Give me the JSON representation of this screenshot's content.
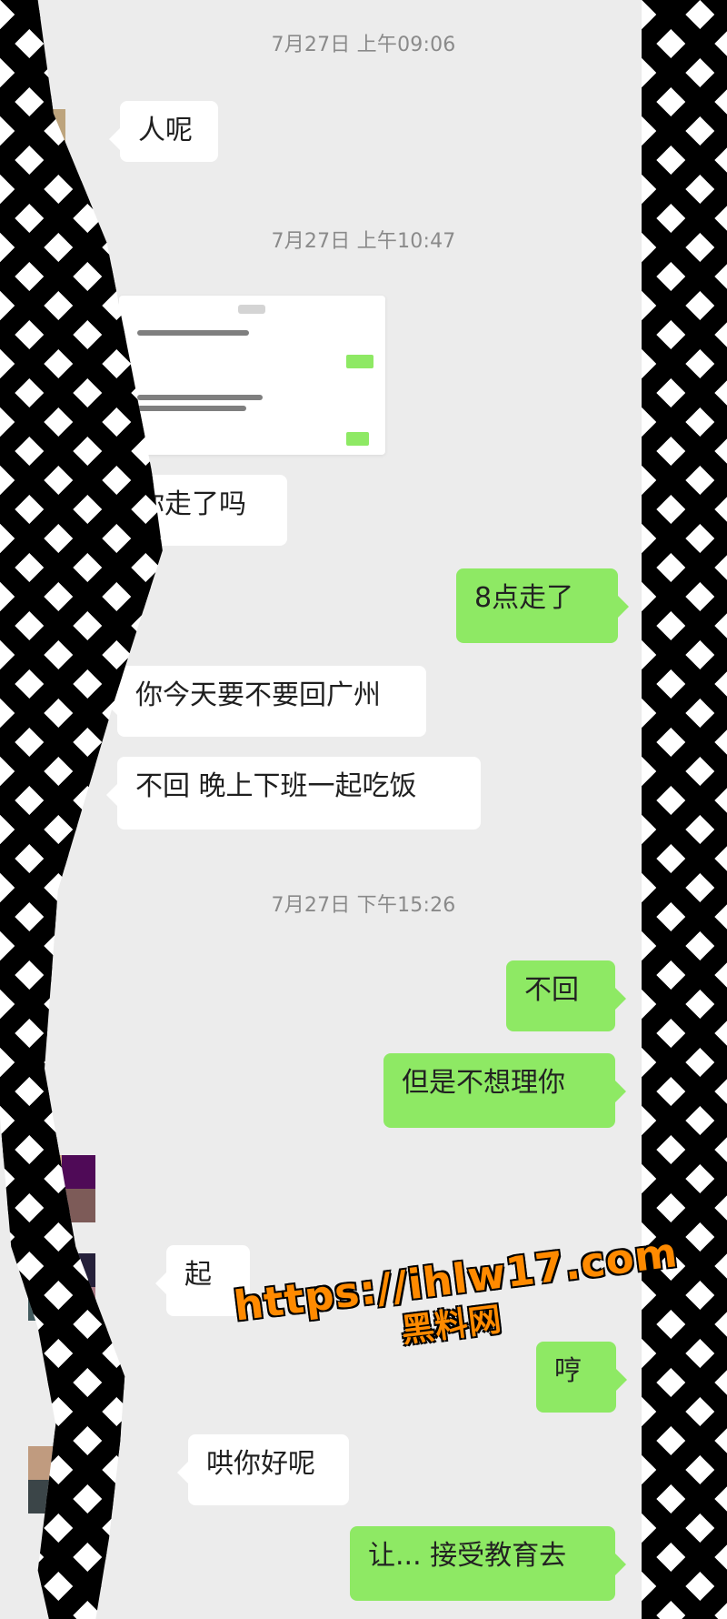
{
  "timestamps": {
    "first": "7月27日 上午09:06",
    "second": "7月27日 上午10:47",
    "third": "7月27日 下午15:26"
  },
  "messages": [
    {
      "side": "left",
      "text": "人呢"
    },
    {
      "side": "left",
      "text": "你走了吗"
    },
    {
      "side": "right",
      "text": "8点走了"
    },
    {
      "side": "left",
      "text": "你今天要不要回广州"
    },
    {
      "side": "left",
      "text": "不回 晚上下班一起吃饭"
    },
    {
      "side": "right",
      "text": "不回"
    },
    {
      "side": "right",
      "text": "但是不想理你"
    },
    {
      "side": "left",
      "text": "起"
    },
    {
      "side": "right",
      "text": "哼"
    },
    {
      "side": "left",
      "text": "哄你好呢"
    },
    {
      "side": "right",
      "text": "让... 接受教育去"
    }
  ],
  "watermark": {
    "url": "https://ihlw17.com",
    "label": "黑料网"
  },
  "colors": {
    "chat_background": "#ececec",
    "left_bubble": "#ffffff",
    "right_bubble": "#8ee964",
    "timestamp_text": "#8a8a8a",
    "watermark_fill": "#ff8a00"
  }
}
